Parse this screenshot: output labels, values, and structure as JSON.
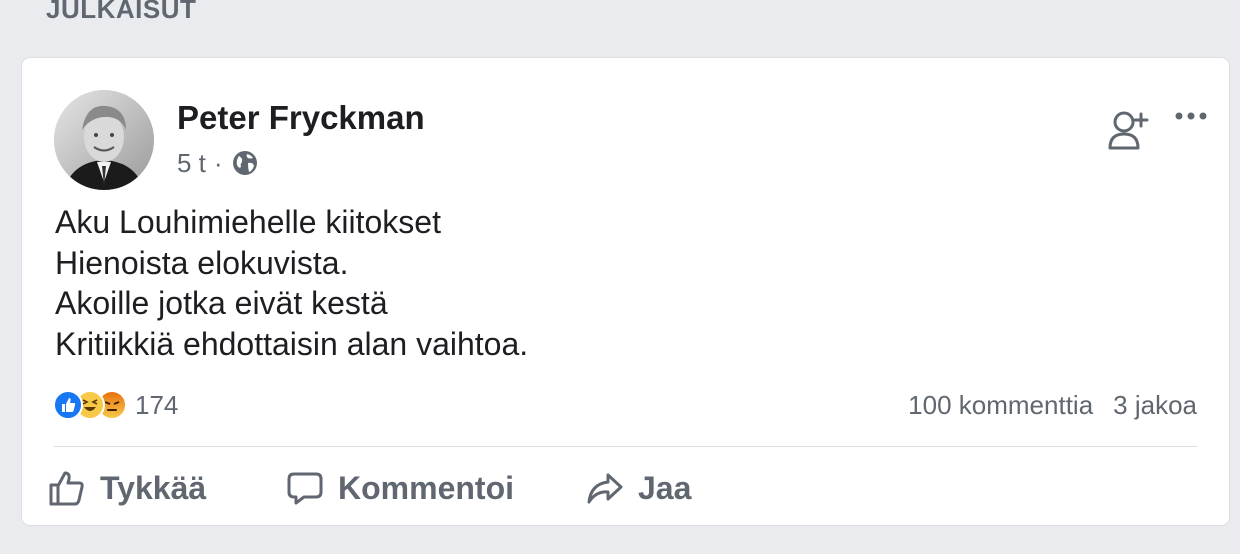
{
  "section": {
    "title": "JULKAISUT"
  },
  "post": {
    "author": "Peter Fryckman",
    "time": "5 t",
    "separator": "·",
    "privacy_icon": "globe-icon",
    "text_lines": [
      "Aku Louhimiehelle kiitokset",
      "Hienoista elokuvista.",
      "Akoille jotka eivät kestä",
      "Kritiikkiä ehdottaisin alan vaihtoa."
    ],
    "reactions": {
      "icons": [
        "like-reaction-icon",
        "haha-reaction-icon",
        "angry-reaction-icon"
      ],
      "count": "174"
    },
    "stats": {
      "comments": "100 kommenttia",
      "shares": "3 jakoa"
    },
    "actions": {
      "like": "Tykkää",
      "comment": "Kommentoi",
      "share": "Jaa"
    },
    "header_icons": [
      "add-friend-icon",
      "more-options-icon"
    ]
  },
  "colors": {
    "background": "#e9ebee",
    "card": "#ffffff",
    "text_primary": "#1c1e21",
    "text_secondary": "#606770",
    "like_blue": "#1877f2",
    "haha_yellow": "#f7c948",
    "angry_orange": "#e9710f"
  }
}
